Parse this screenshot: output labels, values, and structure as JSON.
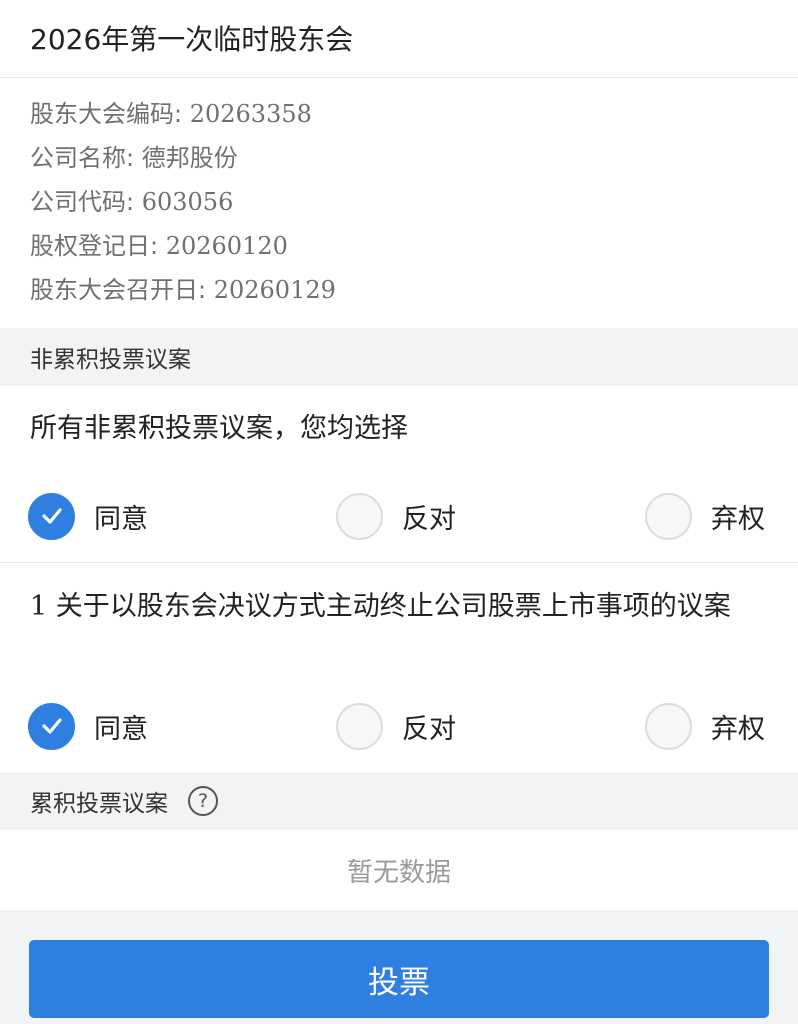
{
  "meeting": {
    "title": "2026年第一次临时股东会"
  },
  "info": [
    {
      "label": "股东大会编码: ",
      "value": "20263358"
    },
    {
      "label": "公司名称: ",
      "value": "德邦股份"
    },
    {
      "label": "公司代码: ",
      "value": "603056"
    },
    {
      "label": "股权登记日: ",
      "value": "20260120"
    },
    {
      "label": "股东大会召开日: ",
      "value": "20260129"
    }
  ],
  "non_cumulative": {
    "header": "非累积投票议案",
    "all_prompt": "所有非累积投票议案，您均选择",
    "all_selected": "同意",
    "proposals": [
      {
        "number": "1",
        "text": " 关于以股东会决议方式主动终止公司股票上市事项的议案",
        "selected": "同意"
      }
    ]
  },
  "options": {
    "agree": "同意",
    "oppose": "反对",
    "abstain": "弃权"
  },
  "cumulative": {
    "header": "累积投票议案",
    "help_icon": "?",
    "empty_text": "暂无数据"
  },
  "actions": {
    "vote_label": "投票"
  },
  "colors": {
    "accent": "#2f7fe0",
    "section_bg": "#f2f3f5"
  }
}
